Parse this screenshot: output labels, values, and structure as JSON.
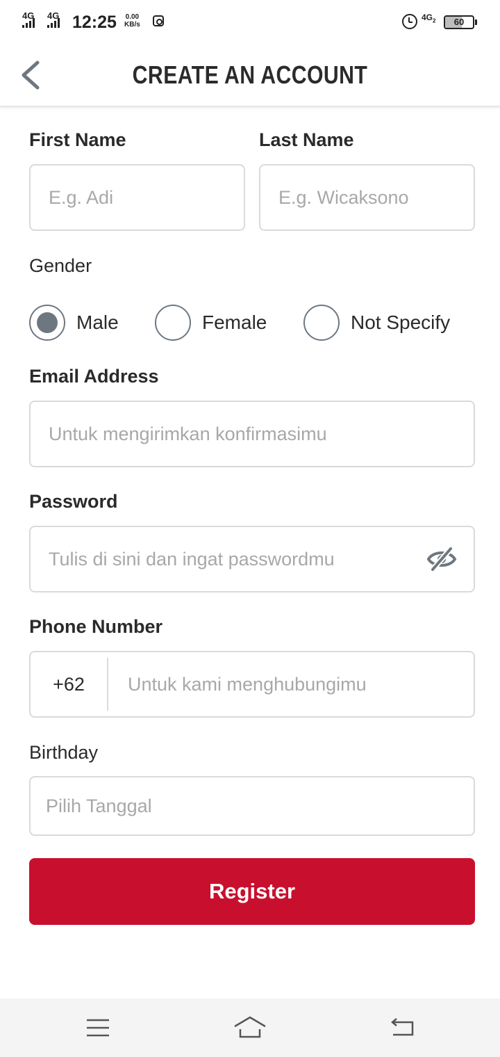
{
  "status_bar": {
    "network1": "4G",
    "network2": "4G",
    "time": "12:25",
    "speed_value": "0.00",
    "speed_unit": "KB/s",
    "network3": "4G",
    "network3_sub": "2",
    "battery_level": "60"
  },
  "header": {
    "title": "CREATE AN ACCOUNT"
  },
  "form": {
    "first_name": {
      "label": "First Name",
      "placeholder": "E.g. Adi"
    },
    "last_name": {
      "label": "Last Name",
      "placeholder": "E.g. Wicaksono"
    },
    "gender": {
      "label": "Gender",
      "options": [
        "Male",
        "Female",
        "Not Specify"
      ],
      "selected": "Male"
    },
    "email": {
      "label": "Email Address",
      "placeholder": "Untuk mengirimkan konfirmasimu"
    },
    "password": {
      "label": "Password",
      "placeholder": "Tulis di sini dan ingat passwordmu"
    },
    "phone": {
      "label": "Phone Number",
      "prefix": "+62",
      "placeholder": "Untuk kami menghubungimu"
    },
    "birthday": {
      "label": "Birthday",
      "placeholder": "Pilih Tanggal"
    },
    "register_label": "Register"
  },
  "colors": {
    "accent": "#c8102e",
    "radio": "#6e7780",
    "border": "#dadada"
  },
  "icons": {
    "back": "chevron-left-icon",
    "password_toggle": "eye-off-icon",
    "nav_menu": "menu-icon",
    "nav_home": "home-icon",
    "nav_back": "back-arrow-icon"
  }
}
